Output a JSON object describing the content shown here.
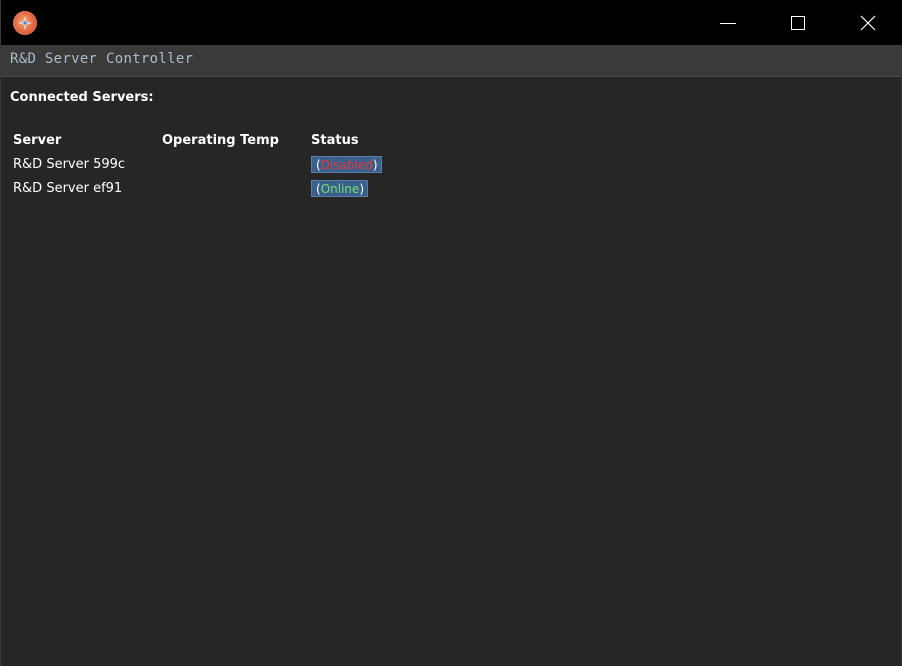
{
  "window": {
    "icon": "app-compass-icon",
    "controls": [
      "minimize-icon",
      "maximize-icon",
      "close-icon"
    ]
  },
  "header": {
    "title": "R&D Server Controller"
  },
  "main": {
    "section_title": "Connected Servers:",
    "columns": [
      "Server",
      "Operating Temp",
      "Status"
    ],
    "rows": [
      {
        "server": "R&D Server 599c",
        "operating_temp": "",
        "status": "Disabled",
        "status_color": "#e23b3b"
      },
      {
        "server": "R&D Server ef91",
        "operating_temp": "",
        "status": "Online",
        "status_color": "#6fe36f"
      }
    ],
    "paren_open": "(",
    "paren_close": ")"
  },
  "colors": {
    "background": "#262626",
    "header_bar": "#3a3a3a",
    "title_text": "#a9bccb",
    "badge_background": "#3a5f8a"
  }
}
